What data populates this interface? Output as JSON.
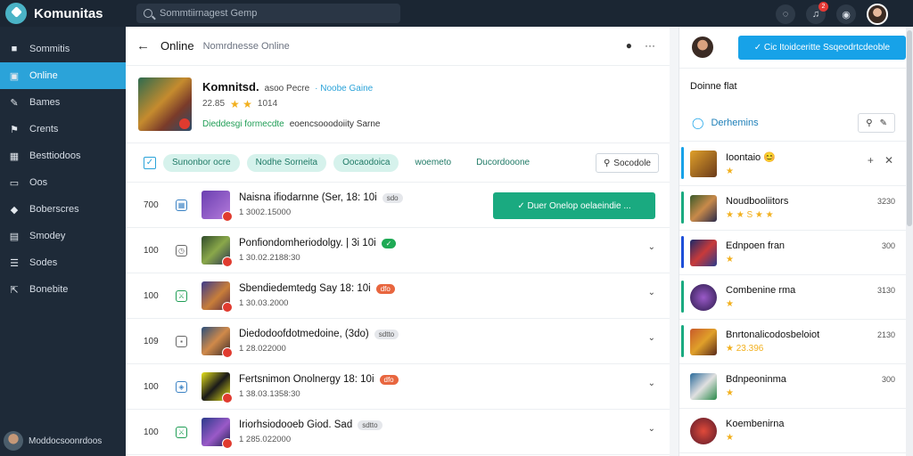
{
  "app": {
    "name": "Komunitas"
  },
  "search": {
    "placeholder": "Sommtiirnagest Gemp"
  },
  "topbar": {
    "icons": [
      "chat-icon",
      "notification-icon",
      "settings-icon"
    ],
    "notification_count": "2"
  },
  "sidebar": {
    "items": [
      {
        "label": "Sommitis",
        "icon": "home-icon"
      },
      {
        "label": "Online",
        "icon": "chat-icon",
        "active": true
      },
      {
        "label": "Bames",
        "icon": "pen-icon"
      },
      {
        "label": "Crents",
        "icon": "flag-icon"
      },
      {
        "label": "Besttiodoos",
        "icon": "grid-icon"
      },
      {
        "label": "Oos",
        "icon": "window-icon"
      },
      {
        "label": "Boberscres",
        "icon": "tag-icon"
      },
      {
        "label": "Smodey",
        "icon": "calendar-icon"
      },
      {
        "label": "Sodes",
        "icon": "list-icon"
      },
      {
        "label": "Bonebite",
        "icon": "export-icon"
      }
    ],
    "user_name": "Moddocsoonrdoos"
  },
  "main": {
    "title": "Online",
    "subtitle": "Nomrdnesse Online",
    "game": {
      "title": "Komnitsd.",
      "subtag": "asoo Pecre",
      "online_label": "· Noobe Gaine",
      "rating_num": "22.85",
      "rating_extra": "1014",
      "tag1": "Dieddesgi formecdte",
      "tag2": "eoencsooodoiity Sarne"
    },
    "filters": {
      "chips": [
        "Sunonbor ocre",
        "Nodhe Sorneita",
        "Oocaodoica"
      ],
      "plain_chips": [
        "woemeto",
        "Ducordooone"
      ],
      "filter_button": "Socodole"
    },
    "rows": [
      {
        "num": "700",
        "title": "Naisna ifiodarnne (Ser, 18: 10i",
        "sub": "1 3002.15000",
        "pill": "sdo",
        "pill_type": "grey",
        "mark": "grid",
        "join": "Duer Onelop oelaeindie ..."
      },
      {
        "num": "100",
        "title": "Ponfiondomheriodolgy. | 3i 10i",
        "sub": "1 30.02.2188:30",
        "pill": "✓",
        "pill_type": "green",
        "mark": "clock"
      },
      {
        "num": "100",
        "title": "Sbendiedemtedg Say 18: 10i",
        "sub": "1 30.03.2000",
        "pill": "dfo",
        "pill_type": "red",
        "mark": "green"
      },
      {
        "num": "109",
        "title": "Diedodoofdotmedoine, (3do)",
        "sub": "1 28.022000",
        "pill": "sdtto",
        "pill_type": "grey",
        "mark": "grey"
      },
      {
        "num": "100",
        "title": "Fertsnimon Onolnergy 18: 10i",
        "sub": "1 38.03.1358:30",
        "pill": "dfo",
        "pill_type": "red",
        "mark": "shield"
      },
      {
        "num": "100",
        "title": "Iriorhsiodooeb Giod. Sad",
        "sub": "1 285.022000",
        "pill": "sdtto",
        "pill_type": "grey",
        "mark": "green"
      }
    ]
  },
  "right": {
    "cta": "Cic Itoidceritte Ssqeodrtcdeoble",
    "heading": "Doinne flat",
    "section_label": "Derhemins",
    "items": [
      {
        "name": "Ioontaio",
        "emoji": "😊",
        "stars": "★",
        "val": "",
        "bar": "#17a2e8"
      },
      {
        "name": "Noudbooliitors",
        "stars": "★ ★ S ★ ★",
        "val": "3230",
        "bar": "#1aaa80"
      },
      {
        "name": "Ednpoen fran",
        "stars": "★",
        "val": "300",
        "bar": "#1d4ed8"
      },
      {
        "name": "Combenine rma",
        "stars": "★",
        "val": "3130",
        "bar": "#1aaa80"
      },
      {
        "name": "Bnrtonalicodosbeloiot",
        "stars": "★ 23.396",
        "val": "2130",
        "bar": "#1aaa80"
      },
      {
        "name": "Bdnpeoninma",
        "stars": "★",
        "val": "300",
        "bar": ""
      },
      {
        "name": "Koembenirna",
        "stars": "★",
        "val": "",
        "bar": ""
      }
    ]
  }
}
